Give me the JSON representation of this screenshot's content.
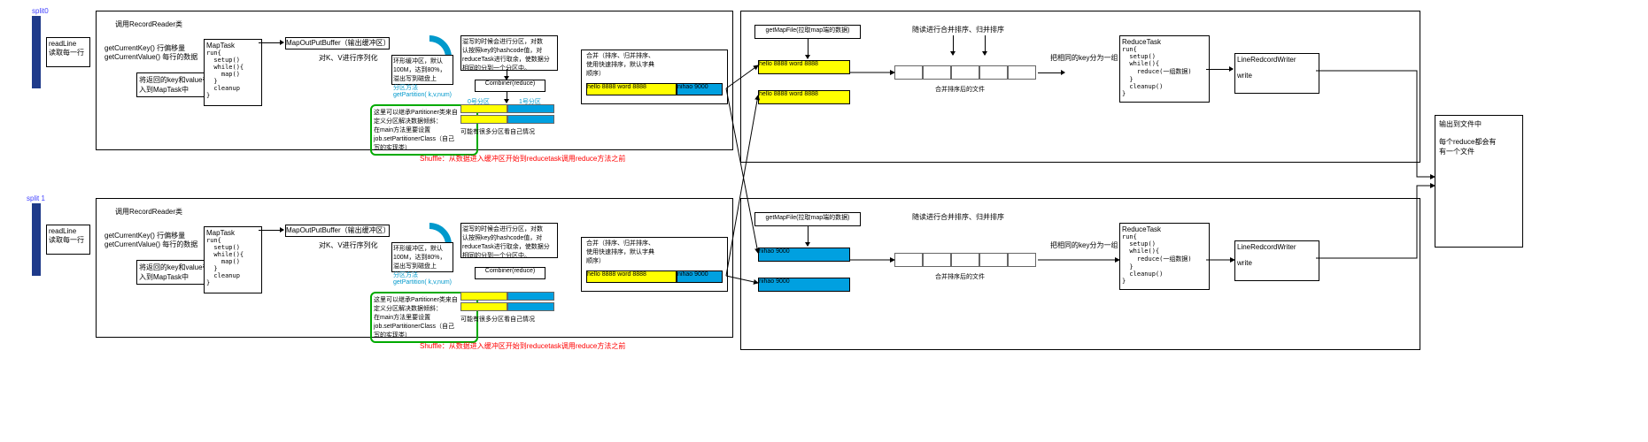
{
  "split0": "split0",
  "split1": "split 1",
  "readLine": {
    "title": "readLine",
    "sub": "读取每一行"
  },
  "recordReader": "调用RecordReader类",
  "getCurrent": {
    "key": "getCurrentKey()  行偏移量",
    "value": "getCurrentValue()  每行的数据"
  },
  "passInto": "将返回的key和value带\n入到MapTask中",
  "mapTask": {
    "title": "MapTask",
    "code": "run{\n  setup()\n  while(){\n    map()\n  }\n  cleanup\n}"
  },
  "mapOutBuffer": "MapOutPutBuffer（输出缓冲区）",
  "serialize": "对K、V进行序列化",
  "ring": {
    "line1": "环形缓冲区，默认",
    "line2": "100M，达到80%，",
    "line3": "溢出写到磁盘上"
  },
  "partMethod": {
    "label": "分区方法",
    "code": "getPartition(\n  k,v,num)"
  },
  "partitioner": "这里可以继承Partitioner类来自\n定义分区解决数据倾斜：\n在main方法里要设置\njob.setPartitionerClass（自己\n写的实现类）",
  "writePart": "溢写的时候会进行分区，对数\n认按照key的hashcode值，对\nreduceTask进行取余，使数据分\n相同的分到一个分区中。",
  "combiner": "Combiner(reduce)",
  "p0": "0号分区",
  "p1": "1号分区",
  "partNote": "可能有很多分区看自己情况",
  "shuffle": "Shuffle：从数据进入缓冲区开始到reducetask调用reduce方法之前",
  "merge": {
    "title": "合并（排序、归并排序、使用快速排序，默认字典顺序）"
  },
  "data": {
    "hello": "hello  8888",
    "word": "word 8888",
    "nihao": "nihao 9000"
  },
  "getMapFile": "getMapFile(拉取map端的数据)",
  "diskMerge": "随读进行合并排序、归并排序",
  "mergedFile": "合并排序后的文件",
  "groupKey": "把相同的key分为一组",
  "reduceTask": {
    "title": "ReduceTask",
    "code": "run{\n  setup()\n  while(){\n    reduce(一组数据)\n  }\n  cleanup()\n}"
  },
  "lineWriter": {
    "title": "LineRedcordWriter",
    "sub": "write"
  },
  "output": {
    "title": "输出到文件中",
    "sub": "每个reduce都会有\n有一个文件"
  }
}
